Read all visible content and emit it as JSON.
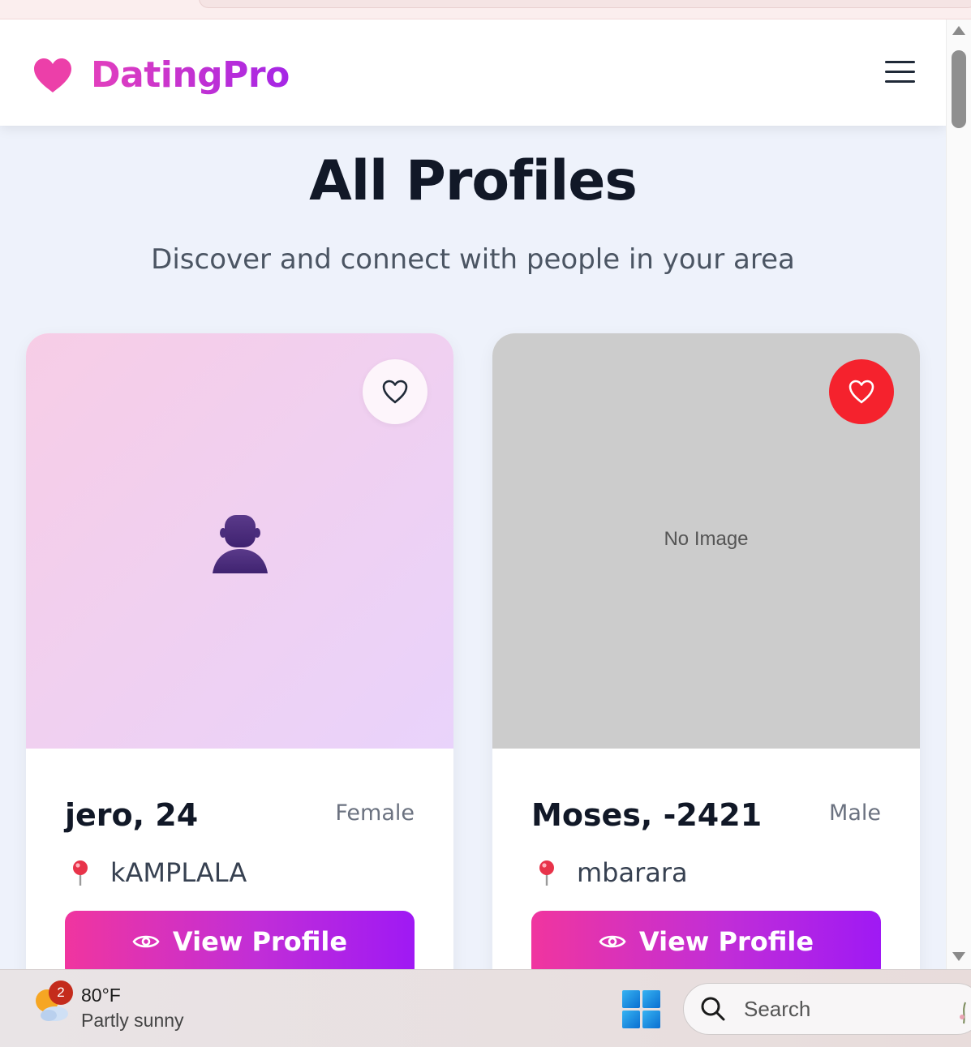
{
  "app": {
    "brand_name": "DatingPro",
    "brand_color_start": "#e23fbd",
    "brand_color_end": "#a526e6"
  },
  "page": {
    "title": "All Profiles",
    "subtitle": "Discover and connect with people in your area"
  },
  "profiles": [
    {
      "name_age": "jero, 24",
      "gender": "Female",
      "location": "kAMPLALA",
      "image": "avatar-placeholder",
      "favorited": false,
      "button_label": "View Profile"
    },
    {
      "name_age": "Moses, -2421",
      "gender": "Male",
      "location": "mbarara",
      "image_placeholder_text": "No Image",
      "favorited": true,
      "button_label": "View Profile"
    }
  ],
  "icons": {
    "brand": "heart-icon",
    "menu": "hamburger-menu-icon",
    "favorite": "heart-outline-icon",
    "location": "pin-icon",
    "view": "eye-icon"
  },
  "colors": {
    "favorite_active": "#f5222d",
    "button_gradient_start": "#f0359f",
    "button_gradient_end": "#9f19f4"
  },
  "taskbar": {
    "weather_badge": "2",
    "weather_temp": "80°F",
    "weather_desc": "Partly sunny",
    "search_label": "Search"
  }
}
